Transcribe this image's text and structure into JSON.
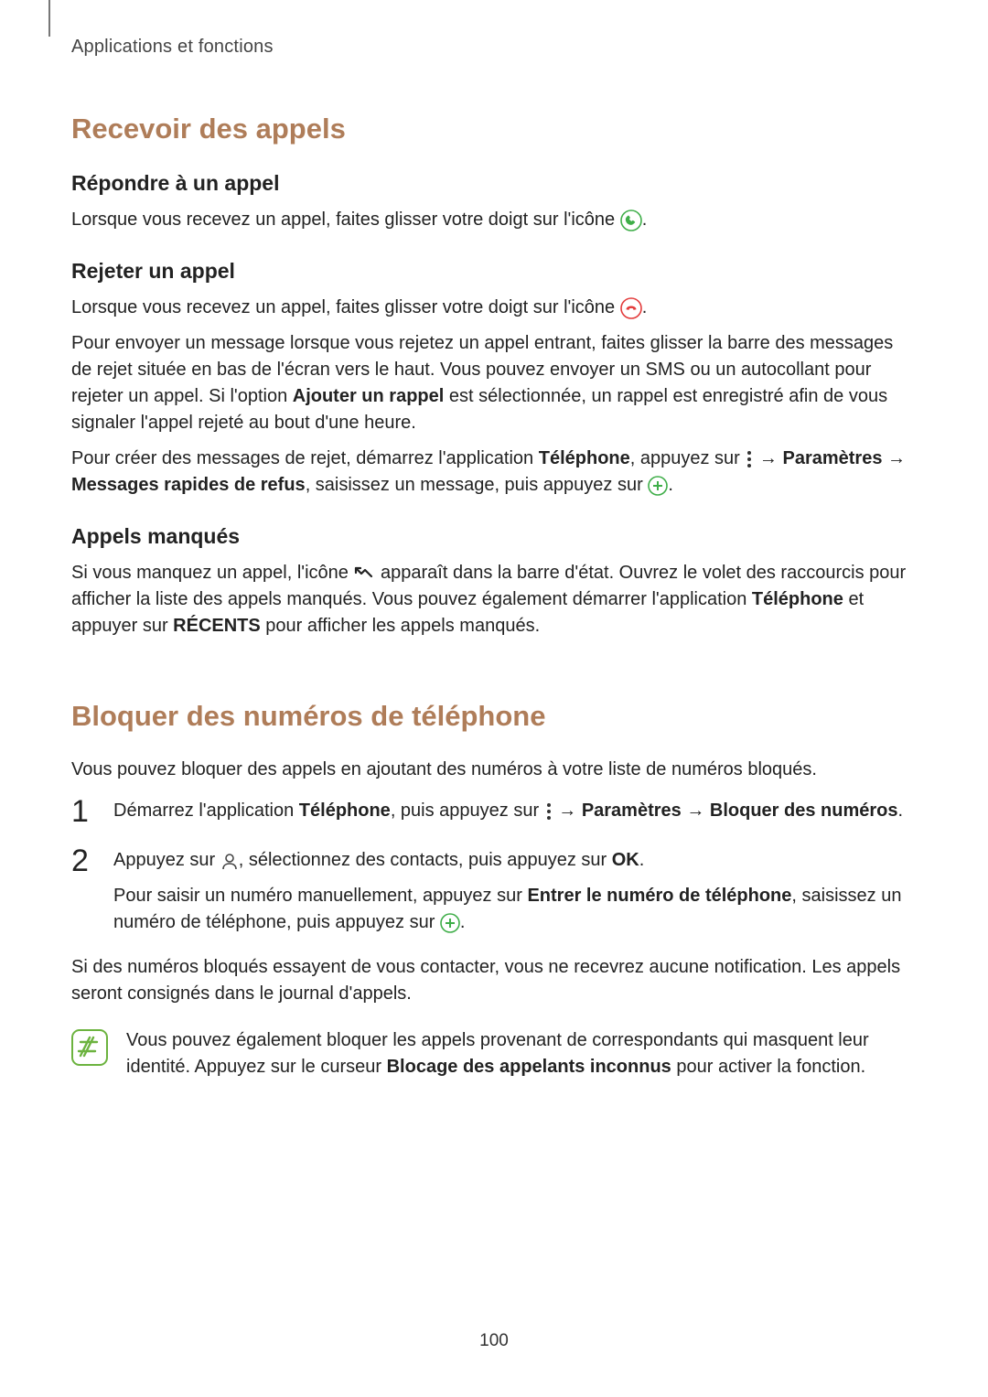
{
  "chapter": "Applications et fonctions",
  "section1": {
    "title": "Recevoir des appels",
    "sub1": {
      "title": "Répondre à un appel",
      "p1a": "Lorsque vous recevez un appel, faites glisser votre doigt sur l'icône ",
      "p1b": "."
    },
    "sub2": {
      "title": "Rejeter un appel",
      "p1a": "Lorsque vous recevez un appel, faites glisser votre doigt sur l'icône ",
      "p1b": ".",
      "p2a": "Pour envoyer un message lorsque vous rejetez un appel entrant, faites glisser la barre des messages de rejet située en bas de l'écran vers le haut. Vous pouvez envoyer un SMS ou un autocollant pour rejeter un appel. Si l'option ",
      "p2b": "Ajouter un rappel",
      "p2c": " est sélectionnée, un rappel est enregistré afin de vous signaler l'appel rejeté au bout d'une heure.",
      "p3a": "Pour créer des messages de rejet, démarrez l'application ",
      "p3b": "Téléphone",
      "p3c": ", appuyez sur ",
      "p3d": " → ",
      "p3e": "Paramètres",
      "p3f": " → ",
      "p3g": "Messages rapides de refus",
      "p3h": ", saisissez un message, puis appuyez sur ",
      "p3i": "."
    },
    "sub3": {
      "title": "Appels manqués",
      "p1a": "Si vous manquez un appel, l'icône ",
      "p1b": " apparaît dans la barre d'état. Ouvrez le volet des raccourcis pour afficher la liste des appels manqués. Vous pouvez également démarrer l'application ",
      "p1c": "Téléphone",
      "p1d": " et appuyer sur ",
      "p1e": "RÉCENTS",
      "p1f": " pour afficher les appels manqués."
    }
  },
  "section2": {
    "title": "Bloquer des numéros de téléphone",
    "p1": "Vous pouvez bloquer des appels en ajoutant des numéros à votre liste de numéros bloqués.",
    "step1": {
      "num": "1",
      "a": "Démarrez l'application ",
      "b": "Téléphone",
      "c": ", puis appuyez sur ",
      "d": " → ",
      "e": "Paramètres",
      "f": " → ",
      "g": "Bloquer des numéros",
      "h": "."
    },
    "step2": {
      "num": "2",
      "a": "Appuyez sur ",
      "b": ", sélectionnez des contacts, puis appuyez sur ",
      "c": "OK",
      "d": ".",
      "p2a": "Pour saisir un numéro manuellement, appuyez sur ",
      "p2b": "Entrer le numéro de téléphone",
      "p2c": ", saisissez un numéro de téléphone, puis appuyez sur ",
      "p2d": "."
    },
    "p2": "Si des numéros bloqués essayent de vous contacter, vous ne recevrez aucune notification. Les appels seront consignés dans le journal d'appels.",
    "note": {
      "a": "Vous pouvez également bloquer les appels provenant de correspondants qui masquent leur identité. Appuyez sur le curseur ",
      "b": "Blocage des appelants inconnus",
      "c": " pour activer la fonction."
    }
  },
  "page_number": "100"
}
